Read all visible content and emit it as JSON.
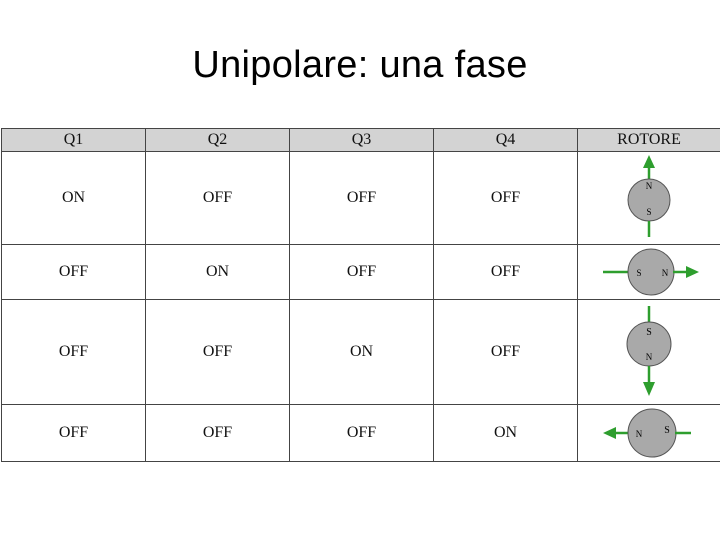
{
  "title": "Unipolare: una fase",
  "table": {
    "headers": [
      "Q1",
      "Q2",
      "Q3",
      "Q4",
      "ROTORE"
    ],
    "rows": [
      {
        "q1": "ON",
        "q2": "OFF",
        "q3": "OFF",
        "q4": "OFF",
        "rotor": {
          "direction": "up",
          "first_pole": "N",
          "second_pole": "S"
        }
      },
      {
        "q1": "OFF",
        "q2": "ON",
        "q3": "OFF",
        "q4": "OFF",
        "rotor": {
          "direction": "right",
          "first_pole": "S",
          "second_pole": "N"
        }
      },
      {
        "q1": "OFF",
        "q2": "OFF",
        "q3": "ON",
        "q4": "OFF",
        "rotor": {
          "direction": "down",
          "first_pole": "S",
          "second_pole": "N"
        }
      },
      {
        "q1": "OFF",
        "q2": "OFF",
        "q3": "OFF",
        "q4": "ON",
        "rotor": {
          "direction": "left",
          "first_pole": "N",
          "second_pole": "S"
        }
      }
    ]
  },
  "colors": {
    "arrow": "#2e9e2e",
    "rotor_fill": "#a9a9a9",
    "header_bg": "#d3d3d3"
  }
}
